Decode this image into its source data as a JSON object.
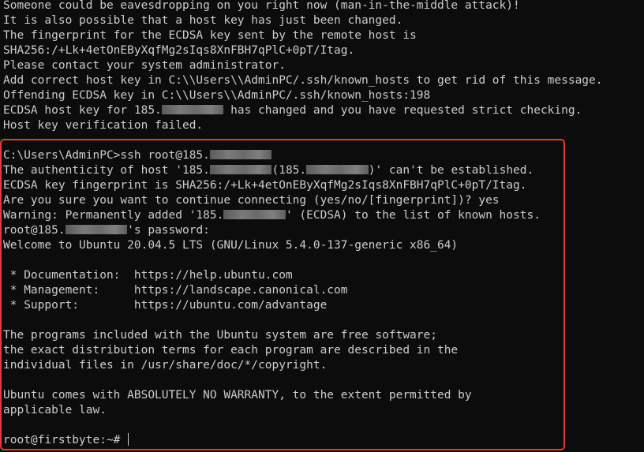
{
  "window": {
    "background": "#0c0c0c",
    "text_color": "#cccccc",
    "highlight_color": "#e03a3a"
  },
  "lines": [
    [
      "Someone could be eavesdropping on you right now (man-in-the-middle attack)!"
    ],
    [
      "It is also possible that a host key has just been changed."
    ],
    [
      "The fingerprint for the ECDSA key sent by the remote host is"
    ],
    [
      "SHA256:/+Lk+4etOnEByXqfMg2sIqs8XnFBH7qPlC+0pT/Itag."
    ],
    [
      "Please contact your system administrator."
    ],
    [
      "Add correct host key in C:\\\\Users\\\\AdminPC/.ssh/known_hosts to get rid of this message."
    ],
    [
      "Offending ECDSA key in C:\\\\Users\\\\AdminPC/.ssh/known_hosts:198"
    ],
    [
      "ECDSA host key for 185.",
      {
        "redact": 9
      },
      " has changed and you have requested strict checking."
    ],
    [
      "Host key verification failed."
    ],
    [
      ""
    ],
    [
      "C:\\Users\\AdminPC>ssh root@185.",
      {
        "redact": 9
      }
    ],
    [
      "The authenticity of host '185.",
      {
        "redact": 9
      },
      "(185.",
      {
        "redact": 9
      },
      ")' can't be established."
    ],
    [
      "ECDSA key fingerprint is SHA256:/+Lk+4etOnEByXqfMg2sIqs8XnFBH7qPlC+0pT/Itag."
    ],
    [
      "Are you sure you want to continue connecting (yes/no/[fingerprint])? yes"
    ],
    [
      "Warning: Permanently added '185.",
      {
        "redact": 9
      },
      "' (ECDSA) to the list of known hosts."
    ],
    [
      "root@185.",
      {
        "redact": 9
      },
      "'s password:"
    ],
    [
      "Welcome to Ubuntu 20.04.5 LTS (GNU/Linux 5.4.0-137-generic x86_64)"
    ],
    [
      ""
    ],
    [
      " * Documentation:  https://help.ubuntu.com"
    ],
    [
      " * Management:     https://landscape.canonical.com"
    ],
    [
      " * Support:        https://ubuntu.com/advantage"
    ],
    [
      ""
    ],
    [
      "The programs included with the Ubuntu system are free software;"
    ],
    [
      "the exact distribution terms for each program are described in the"
    ],
    [
      "individual files in /usr/share/doc/*/copyright."
    ],
    [
      ""
    ],
    [
      "Ubuntu comes with ABSOLUTELY NO WARRANTY, to the extent permitted by"
    ],
    [
      "applicable law."
    ],
    [
      ""
    ],
    [
      "root@firstbyte:~# ",
      {
        "cursor": true
      }
    ]
  ]
}
